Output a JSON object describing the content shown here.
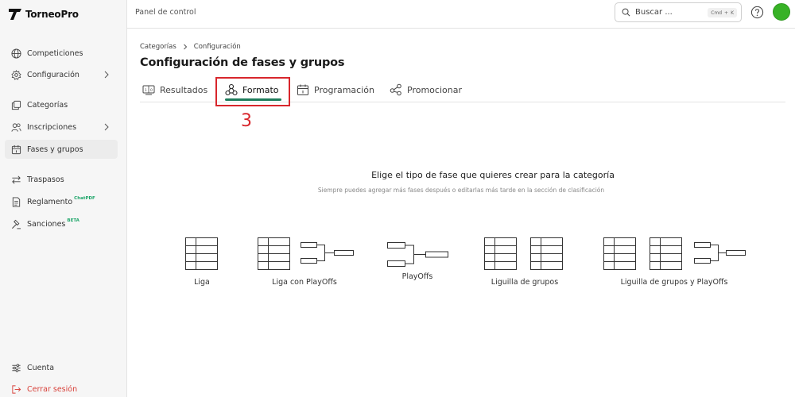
{
  "app": {
    "name": "TorneoPro"
  },
  "topbar": {
    "title": "Panel de control",
    "search_placeholder": "Buscar ...",
    "kbd_cmd": "Cmd",
    "kbd_plus": "+",
    "kbd_key": "K"
  },
  "sidebar": {
    "items": [
      {
        "label": "Competiciones",
        "icon": "globe-icon"
      },
      {
        "label": "Configuración",
        "icon": "gear-icon",
        "chevron": true
      },
      {
        "label": "Categorías",
        "icon": "layers-icon"
      },
      {
        "label": "Inscripciones",
        "icon": "users-icon",
        "chevron": true
      },
      {
        "label": "Fases y grupos",
        "icon": "calendar-icon",
        "active": true
      },
      {
        "label": "Traspasos",
        "icon": "transfer-icon"
      },
      {
        "label": "Reglamento",
        "icon": "document-icon",
        "badge": "ChatPDF"
      },
      {
        "label": "Sanciones",
        "icon": "gavel-icon",
        "badge": "BETA"
      }
    ],
    "account_label": "Cuenta",
    "logout_label": "Cerrar sesión"
  },
  "breadcrumb": {
    "items": [
      "Categorías",
      "Configuración"
    ]
  },
  "page": {
    "title": "Configuración de fases y grupos"
  },
  "tabs": [
    {
      "label": "Resultados",
      "icon": "scoreboard-icon"
    },
    {
      "label": "Formato",
      "icon": "hierarchy-icon",
      "active": true
    },
    {
      "label": "Programación",
      "icon": "calendar-icon"
    },
    {
      "label": "Promocionar",
      "icon": "share-icon"
    }
  ],
  "annotation": {
    "step": "3"
  },
  "section": {
    "heading": "Elige el tipo de fase que quieres crear para la categoría",
    "subheading": "Siempre puedes agregar más fases después o editarlas más tarde en la sección de clasificación"
  },
  "options": [
    {
      "label": "Liga"
    },
    {
      "label": "Liga con PlayOffs"
    },
    {
      "label": "PlayOffs"
    },
    {
      "label": "Liguilla de grupos"
    },
    {
      "label": "Liguilla de grupos y PlayOffs"
    }
  ],
  "colors": {
    "accent": "#1e7d5c",
    "highlight": "#d8262c",
    "avatar": "#37b226",
    "logout": "#d8413a"
  }
}
